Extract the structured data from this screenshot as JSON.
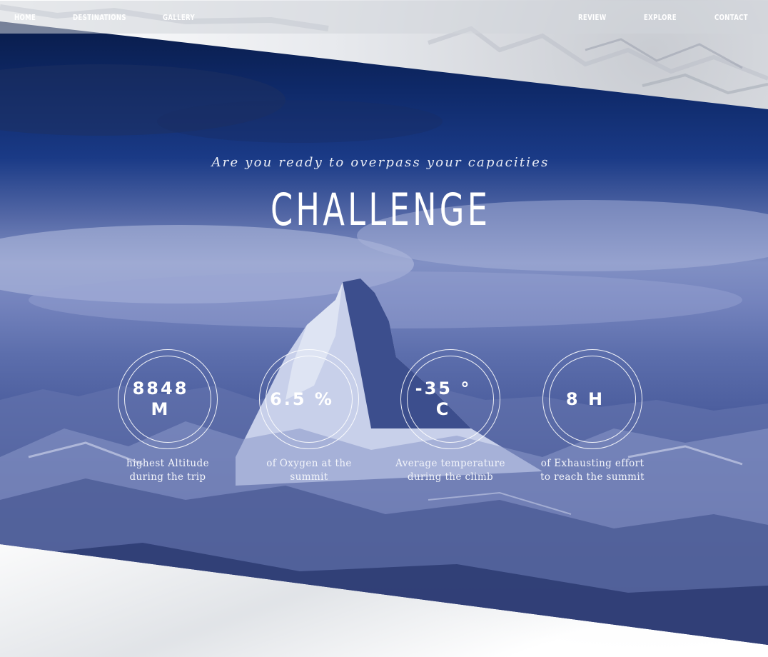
{
  "nav": {
    "left": [
      "HOME",
      "DESTINATIONS",
      "GALLERY"
    ],
    "right": [
      "REVIEW",
      "EXPLORE",
      "CONTACT"
    ]
  },
  "hero": {
    "subtitle": "Are you ready to overpass your capacities",
    "title": "CHALLENGE"
  },
  "stats": [
    {
      "value": "8848 M",
      "label": "highest Altitude during the trip"
    },
    {
      "value": "6.5 %",
      "label": "of Oxygen at the summit"
    },
    {
      "value": "-35 ° C",
      "label": "Average temperature during the climb"
    },
    {
      "value": "8 H",
      "label": "of Exhausting effort to reach the summit"
    }
  ],
  "colors": {
    "band_dark": "#07173f",
    "band_mid": "#5468a6",
    "text": "#ffffff"
  }
}
